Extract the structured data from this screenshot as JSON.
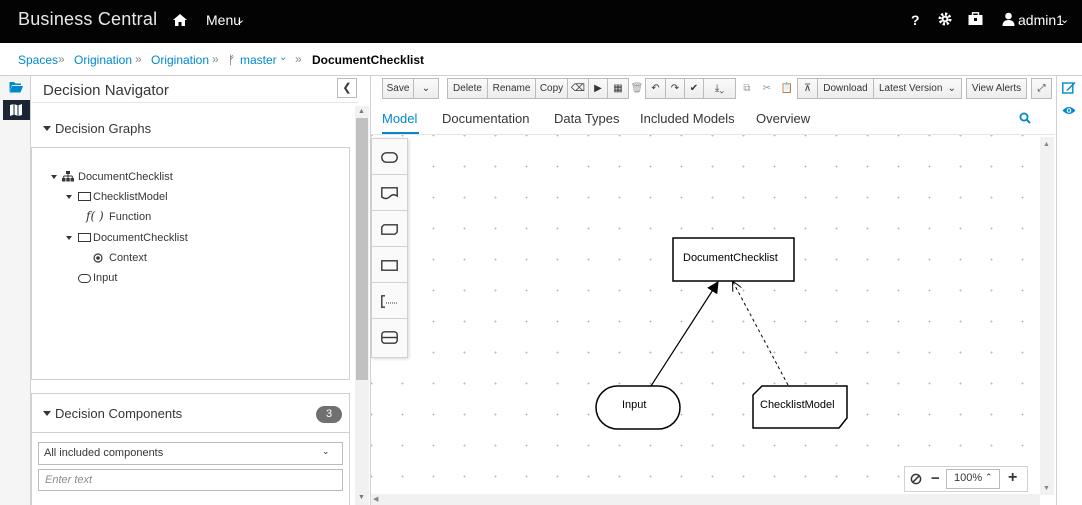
{
  "topbar": {
    "brand": "Business Central",
    "menu_label": "Menu",
    "help_label": "?",
    "user_name": "admin1"
  },
  "breadcrumb": {
    "items": [
      "Spaces",
      "Origination",
      "Origination",
      "master"
    ],
    "branch_prefix": "ᚠ",
    "current": "DocumentChecklist"
  },
  "navigator": {
    "title": "Decision Navigator",
    "graphs_title": "Decision Graphs",
    "tree": [
      {
        "label": "DocumentChecklist",
        "icon": "hierarchy-icon"
      },
      {
        "label": "ChecklistModel",
        "icon": "rectangle-icon"
      },
      {
        "label": "Function",
        "icon": "function-icon",
        "icon_text": "f( )"
      },
      {
        "label": "DocumentChecklist",
        "icon": "rectangle-icon"
      },
      {
        "label": "Context",
        "icon": "context-icon"
      },
      {
        "label": "Input",
        "icon": "oval-icon"
      }
    ],
    "components_title": "Decision Components",
    "components_count": "3",
    "components_select": "All included components",
    "filter_placeholder": "Enter text"
  },
  "toolbar": {
    "save": "Save",
    "delete": "Delete",
    "rename": "Rename",
    "copy": "Copy",
    "download": "Download",
    "latest_version": "Latest Version",
    "view_alerts": "View Alerts"
  },
  "tabs": [
    "Model",
    "Documentation",
    "Data Types",
    "Included Models",
    "Overview"
  ],
  "active_tab": "Model",
  "diagram": {
    "nodes": [
      {
        "id": "decision",
        "label": "DocumentChecklist",
        "shape": "rectangle"
      },
      {
        "id": "input",
        "label": "Input",
        "shape": "oval"
      },
      {
        "id": "bkm",
        "label": "ChecklistModel",
        "shape": "clipped-rectangle"
      }
    ],
    "edges": [
      {
        "from": "input",
        "to": "decision",
        "style": "solid"
      },
      {
        "from": "bkm",
        "to": "decision",
        "style": "dashed"
      }
    ]
  },
  "zoom": {
    "level": "100%"
  },
  "colors": {
    "accent": "#0088ce",
    "topbar": "#030303",
    "active_tab_strip": "#1a2434"
  }
}
